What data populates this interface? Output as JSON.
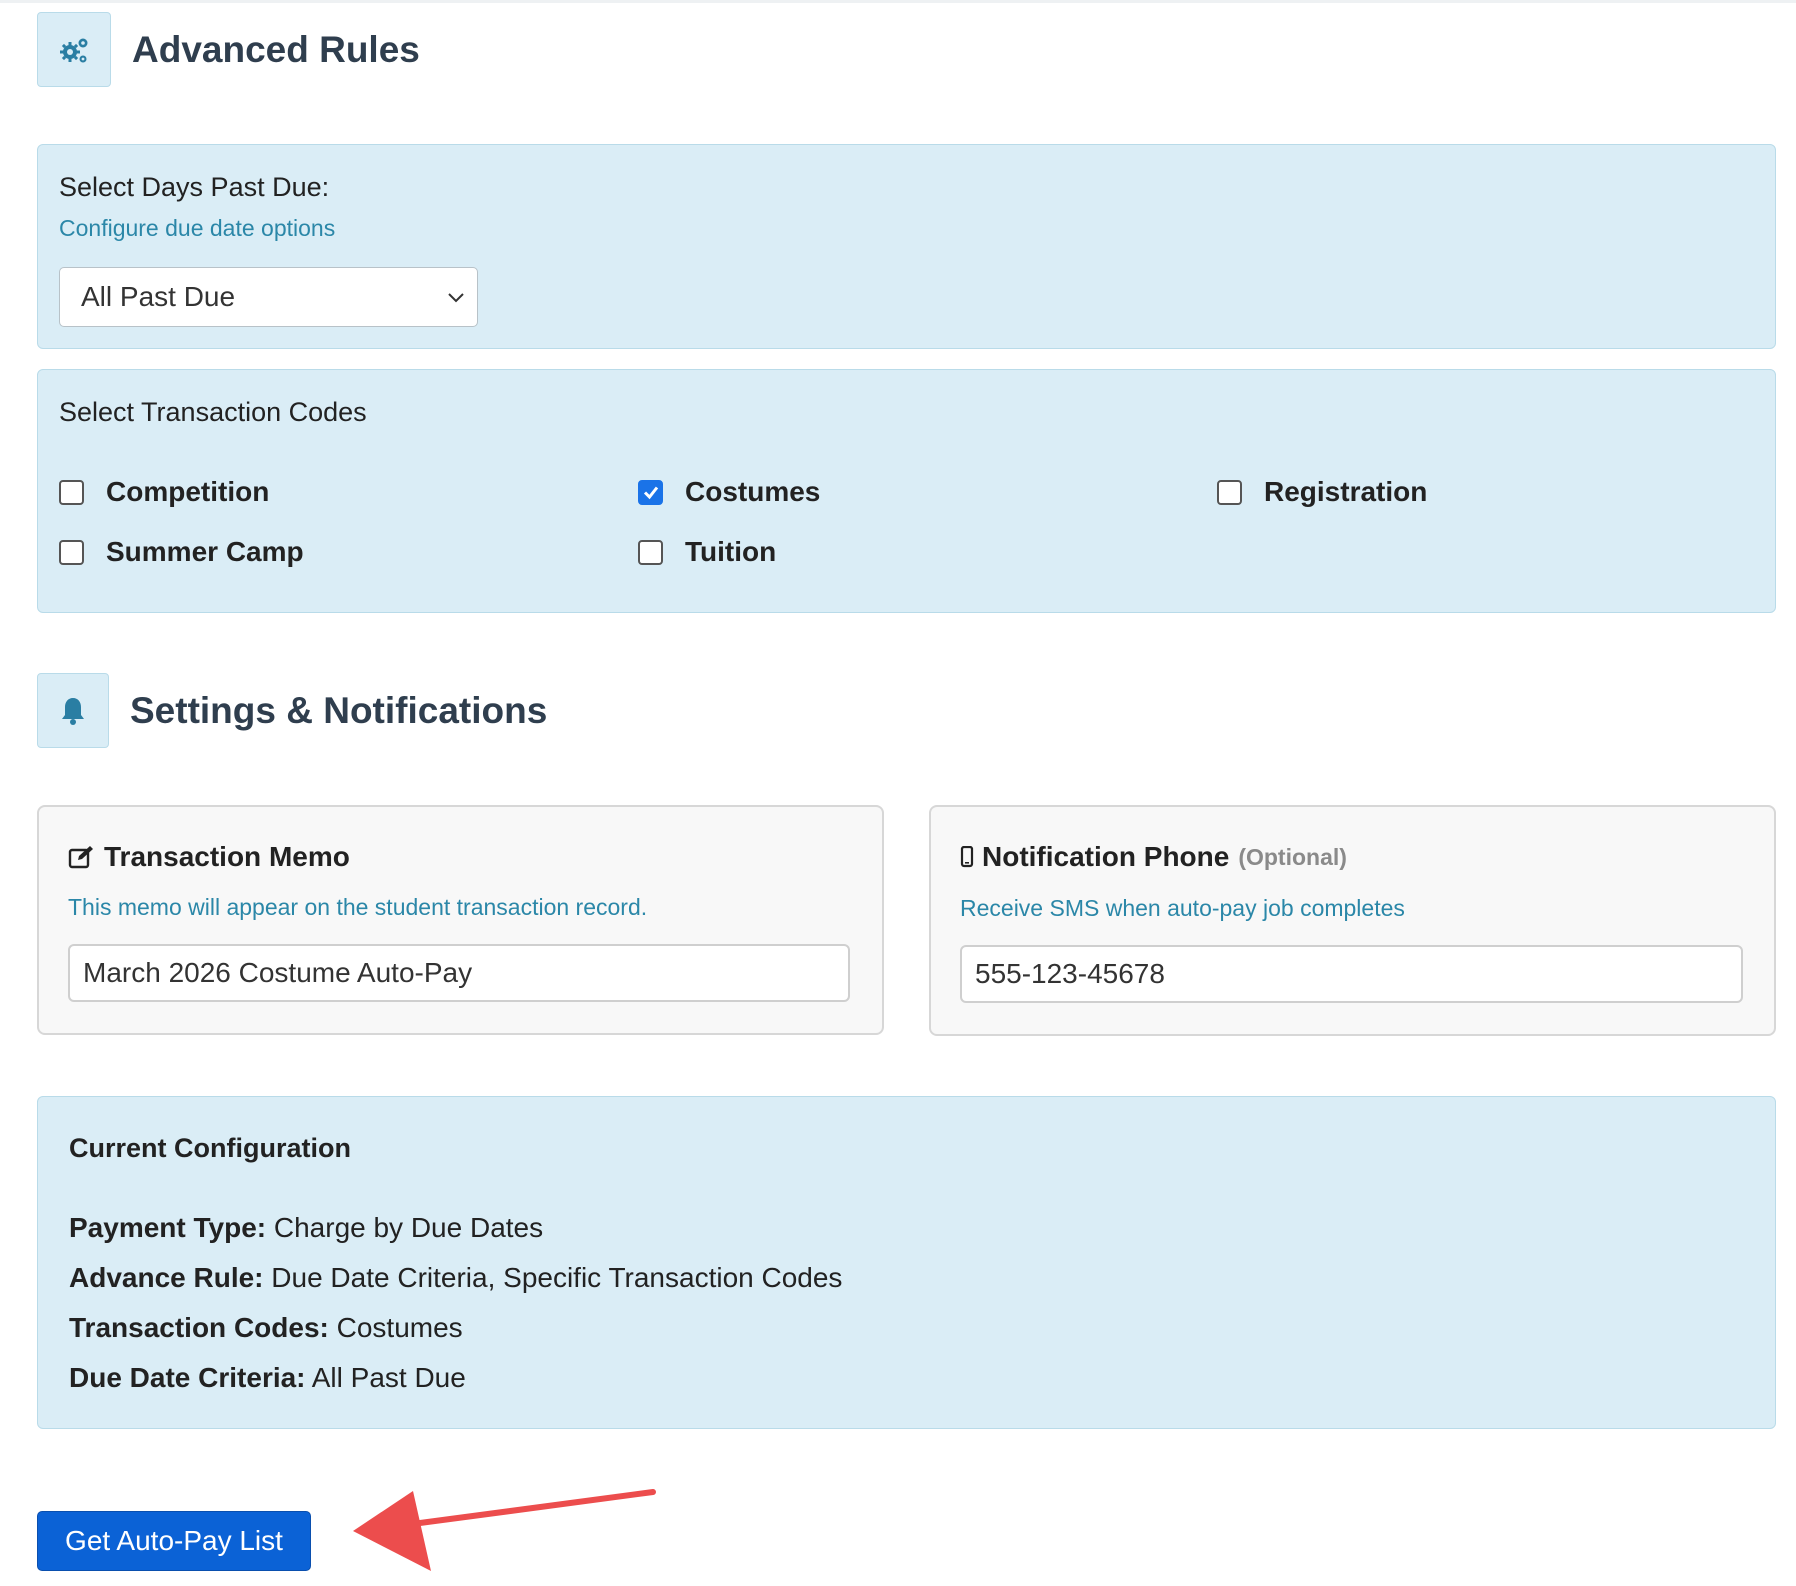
{
  "advanced_rules": {
    "title": "Advanced Rules",
    "icon": "gears-icon"
  },
  "days_past_due": {
    "label": "Select Days Past Due:",
    "help_link": "Configure due date options",
    "selected": "All Past Due"
  },
  "transaction_codes": {
    "label": "Select Transaction Codes",
    "items": [
      {
        "label": "Competition",
        "checked": false
      },
      {
        "label": "Costumes",
        "checked": true
      },
      {
        "label": "Registration",
        "checked": false
      },
      {
        "label": "Summer Camp",
        "checked": false
      },
      {
        "label": "Tuition",
        "checked": false
      }
    ]
  },
  "settings": {
    "title": "Settings & Notifications",
    "icon": "bell-icon"
  },
  "memo_card": {
    "icon": "edit-icon",
    "title": "Transaction Memo",
    "help": "This memo will appear on the student transaction record.",
    "value": "March 2026 Costume Auto-Pay"
  },
  "phone_card": {
    "icon": "mobile-phone-icon",
    "title": "Notification Phone",
    "optional": "(Optional)",
    "help": "Receive SMS when auto-pay job completes",
    "value": "555-123-45678"
  },
  "current_config": {
    "title": "Current Configuration",
    "lines": [
      {
        "key": "Payment Type:",
        "value": "Charge by Due Dates"
      },
      {
        "key": "Advance Rule:",
        "value": "Due Date Criteria, Specific Transaction Codes"
      },
      {
        "key": "Transaction Codes:",
        "value": "Costumes"
      },
      {
        "key": "Due Date Criteria:",
        "value": "All Past Due"
      }
    ]
  },
  "actions": {
    "get_list_label": "Get Auto-Pay List"
  },
  "colors": {
    "panel_bg": "#daedf6",
    "help_text": "#2b87a8",
    "primary_button": "#0b62d6",
    "annotation_arrow": "#ec4d4d"
  }
}
